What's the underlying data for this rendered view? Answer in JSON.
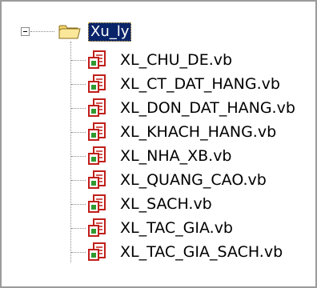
{
  "tree": {
    "root": {
      "label": "Xu_ly",
      "expanded": true,
      "selected": true,
      "icon": "folder-icon"
    },
    "items": [
      {
        "label": "XL_CHU_DE.vb",
        "icon": "vb-file-icon"
      },
      {
        "label": "XL_CT_DAT_HANG.vb",
        "icon": "vb-file-icon"
      },
      {
        "label": "XL_DON_DAT_HANG.vb",
        "icon": "vb-file-icon"
      },
      {
        "label": "XL_KHACH_HANG.vb",
        "icon": "vb-file-icon"
      },
      {
        "label": "XL_NHA_XB.vb",
        "icon": "vb-file-icon"
      },
      {
        "label": "XL_QUANG_CAO.vb",
        "icon": "vb-file-icon"
      },
      {
        "label": "XL_SACH.vb",
        "icon": "vb-file-icon"
      },
      {
        "label": "XL_TAC_GIA.vb",
        "icon": "vb-file-icon"
      },
      {
        "label": "XL_TAC_GIA_SACH.vb",
        "icon": "vb-file-icon"
      }
    ],
    "colors": {
      "selection": "#0a246a",
      "icon_red": "#c0201a",
      "icon_green": "#2f9a2f"
    }
  }
}
